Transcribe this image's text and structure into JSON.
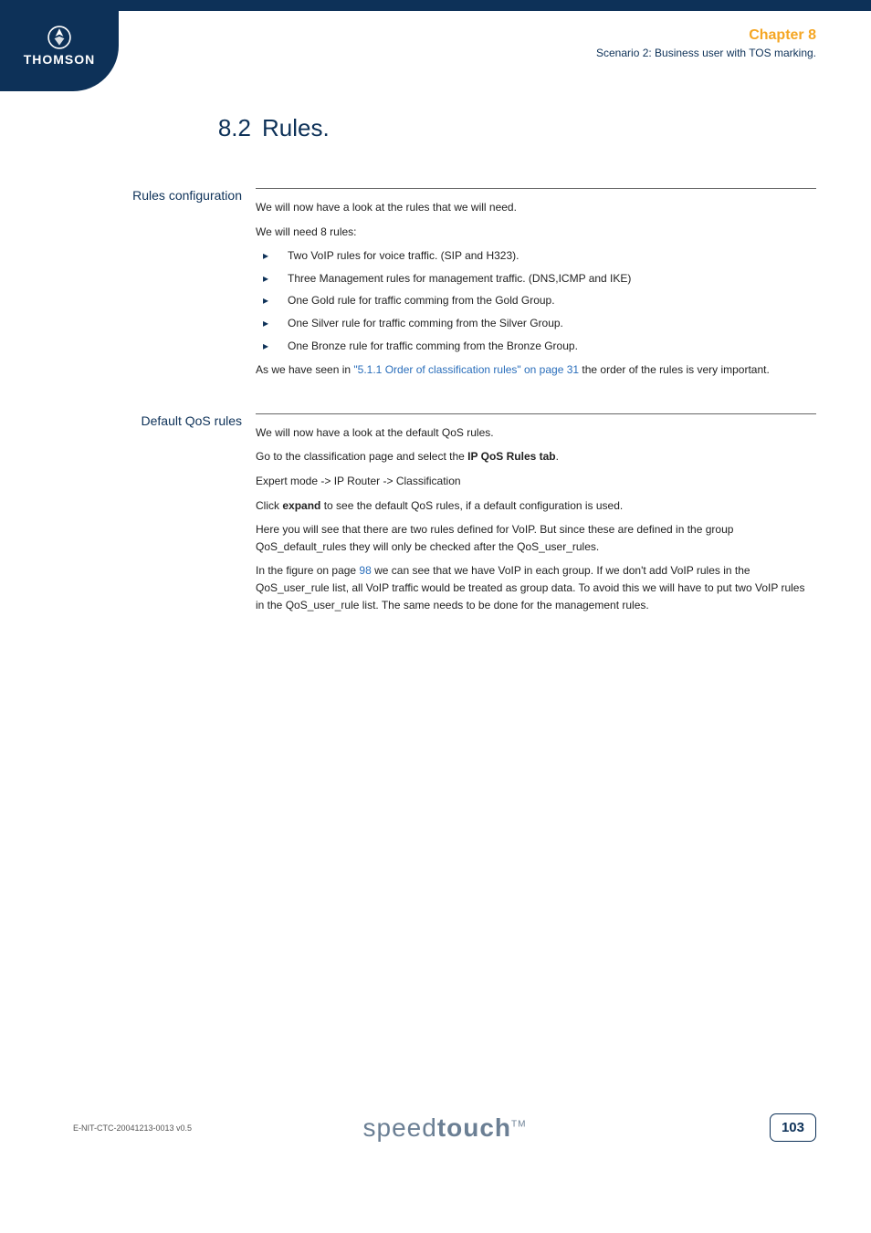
{
  "logo": {
    "text": "THOMSON"
  },
  "header": {
    "chapter": "Chapter 8",
    "scenario": "Scenario 2: Business user with TOS marking."
  },
  "section": {
    "num": "8.2",
    "title": "Rules."
  },
  "subs": {
    "rules_config": {
      "label": "Rules configuration",
      "p1": "We will now have a look at the rules that we will need.",
      "p2": "We will need 8 rules:",
      "items": [
        "Two VoIP rules for voice traffic. (SIP and H323).",
        "Three Management rules for management traffic. (DNS,ICMP and IKE)",
        "One Gold rule for traffic comming from the Gold Group.",
        "One Silver rule for traffic comming from the Silver Group.",
        "One Bronze rule for traffic comming from the Bronze Group."
      ],
      "p3a": "As we have seen in ",
      "p3_link": "\"5.1.1 Order of classification rules\" on page 31",
      "p3b": " the order of the rules is very important."
    },
    "default_qos": {
      "label": "Default QoS rules",
      "p1": "We will now have a look at the default QoS rules.",
      "p2a": "Go to the classification page and select the ",
      "p2_bold": "IP QoS Rules tab",
      "p2b": ".",
      "p3": "Expert mode -> IP Router -> Classification",
      "p4a": "Click ",
      "p4_bold": "expand",
      "p4b": " to see the default QoS rules, if a default configuration is used.",
      "p5": "Here you will see that there are two rules defined for VoIP. But since these are defined in the group QoS_default_rules they will only be checked after the QoS_user_rules.",
      "p6a": "In the figure on page ",
      "p6_link": "98",
      "p6b": " we can see that we have VoIP in each group. If we don't add VoIP rules in the QoS_user_rule list, all VoIP traffic would be treated as group data. To avoid this we will have to put two VoIP rules in the QoS_user_rule list. The same needs to be done for the management rules."
    }
  },
  "footer": {
    "ref": "E-NIT-CTC-20041213-0013 v0.5",
    "brand_light": "speed",
    "brand_bold": "touch",
    "brand_tm": "TM",
    "page": "103"
  }
}
